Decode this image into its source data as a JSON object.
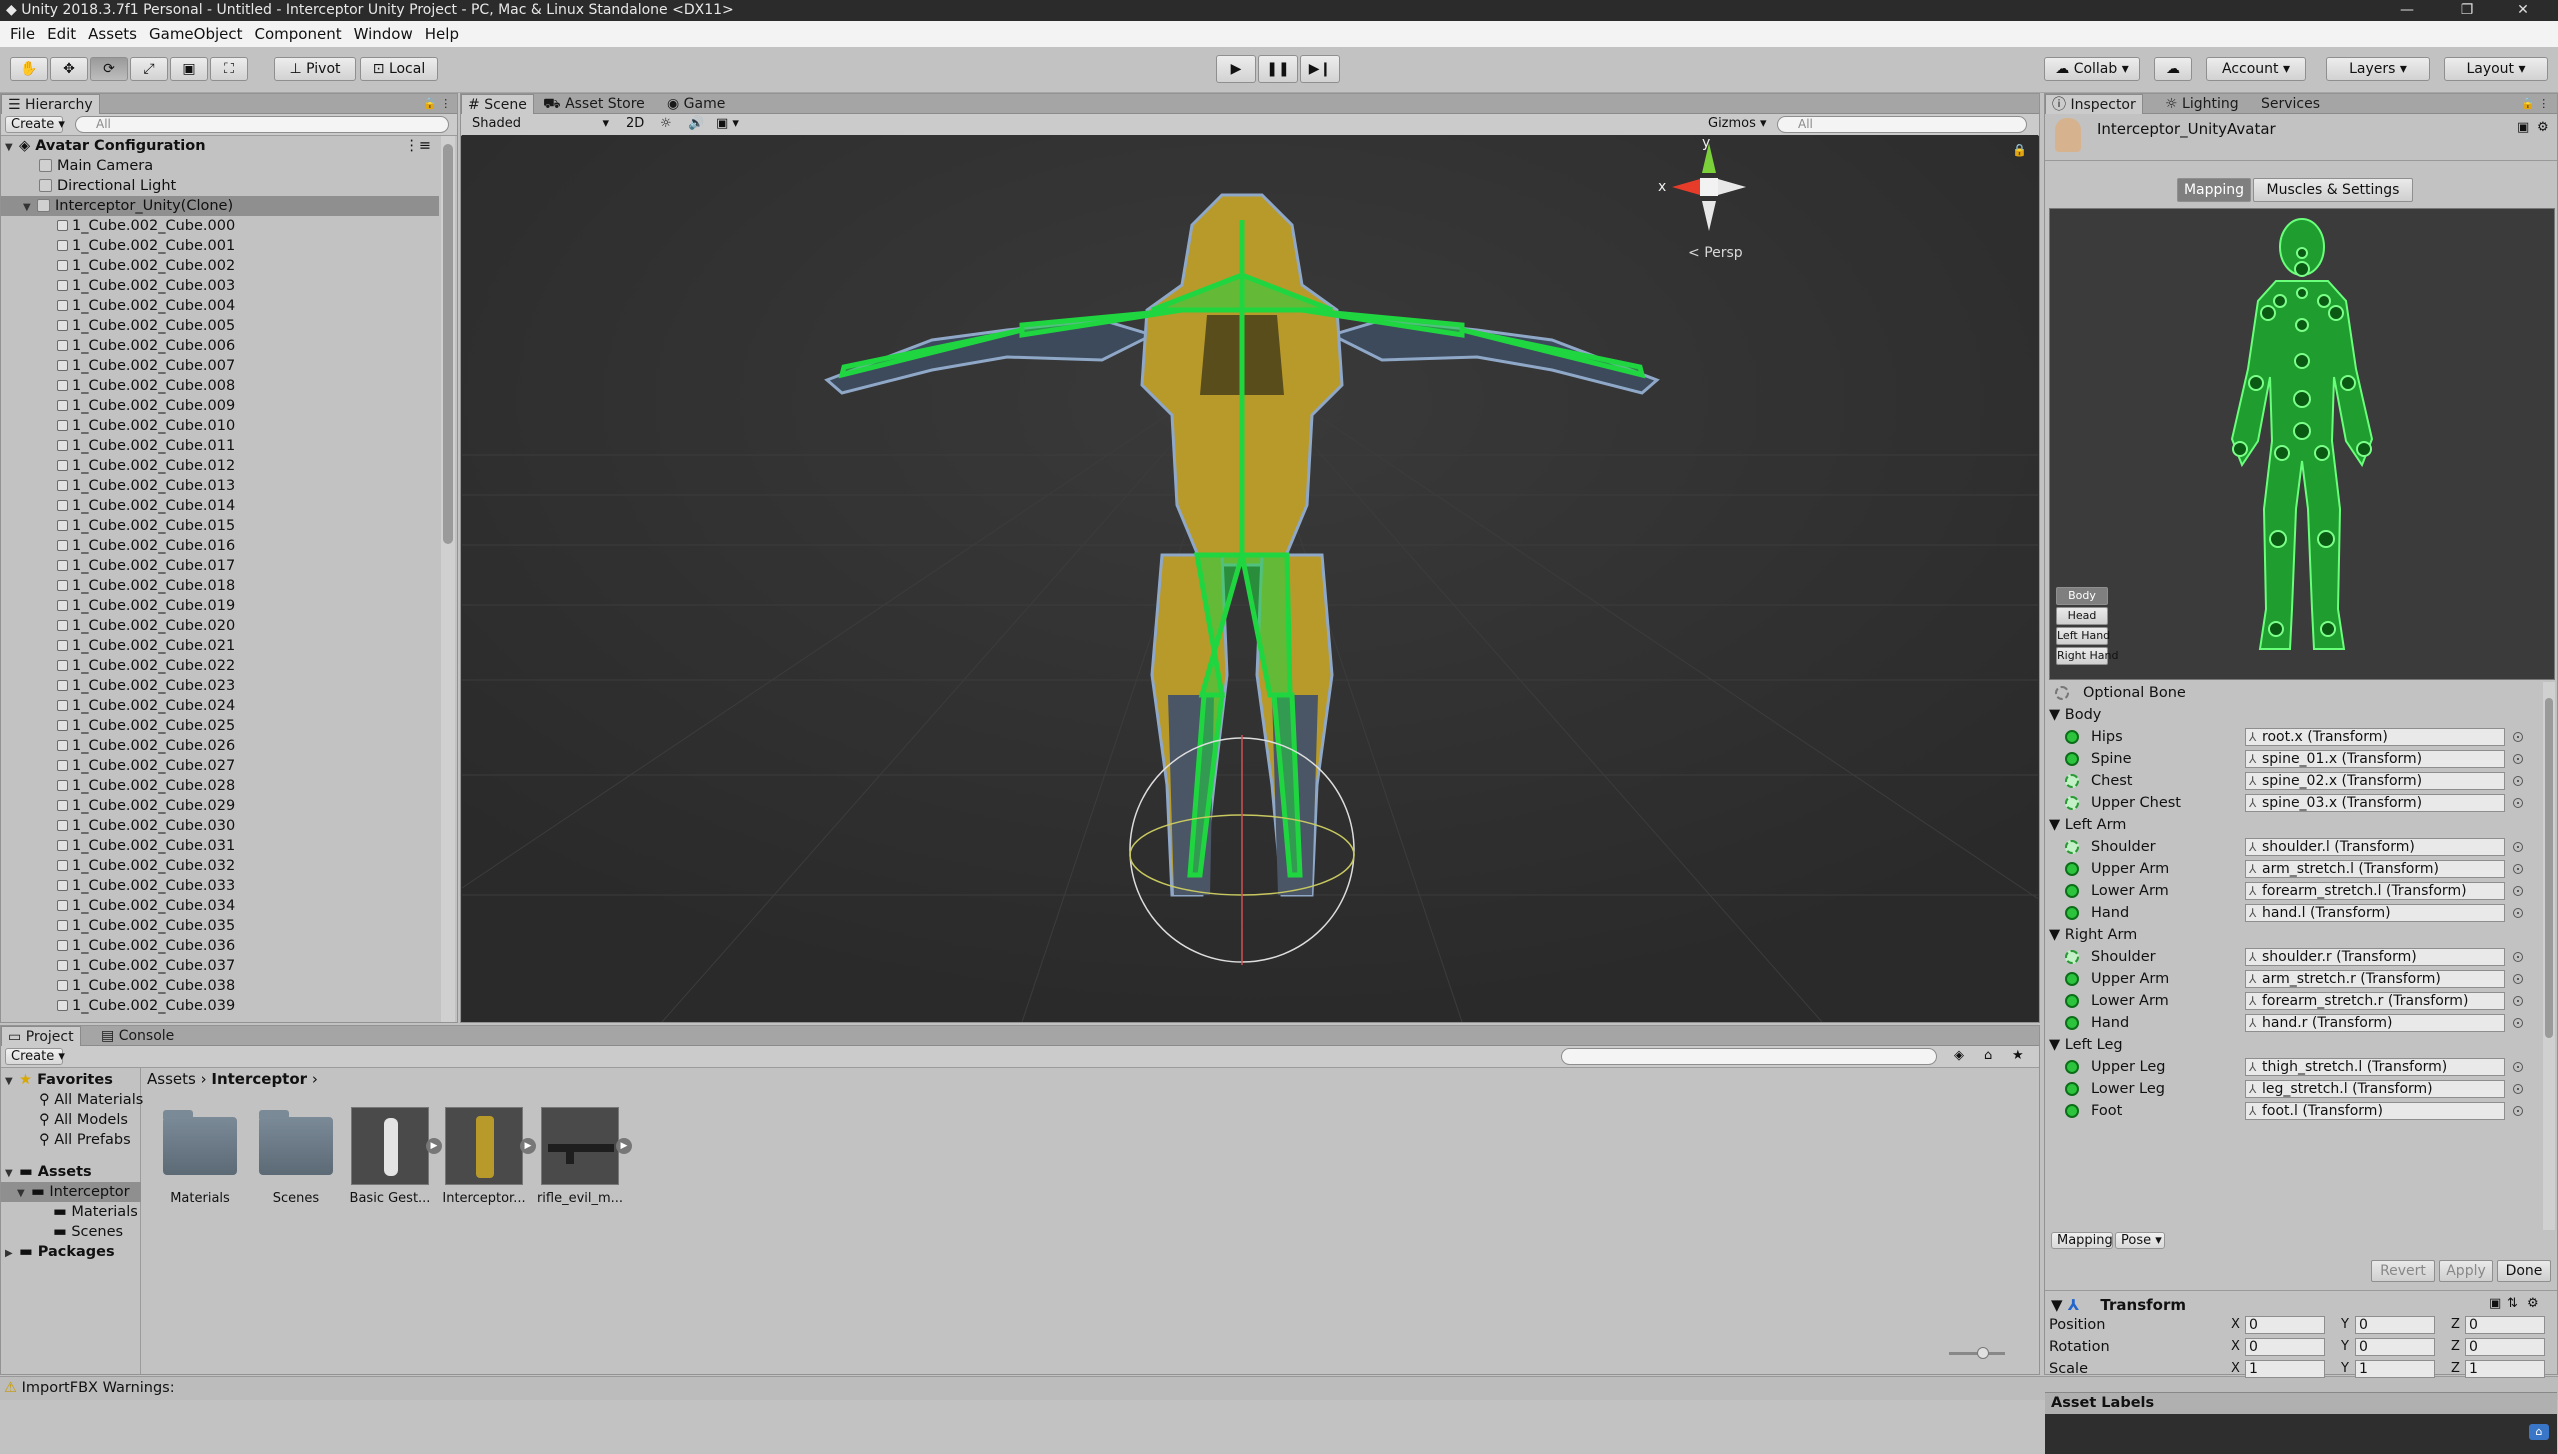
{
  "window": {
    "title": "Unity 2018.3.7f1 Personal - Untitled - Interceptor Unity Project - PC, Mac & Linux Standalone <DX11>"
  },
  "menu": [
    "File",
    "Edit",
    "Assets",
    "GameObject",
    "Component",
    "Window",
    "Help"
  ],
  "toolbar": {
    "pivot": "Pivot",
    "local": "Local",
    "collab": "Collab",
    "account": "Account",
    "layers": "Layers",
    "layout": "Layout"
  },
  "hierarchy": {
    "tab": "Hierarchy",
    "create": "Create",
    "search_placeholder": "All",
    "scene_name": "Avatar Configuration",
    "items": [
      "Main Camera",
      "Directional Light",
      "Interceptor_Unity(Clone)"
    ],
    "children": [
      "1_Cube.002_Cube.000",
      "1_Cube.002_Cube.001",
      "1_Cube.002_Cube.002",
      "1_Cube.002_Cube.003",
      "1_Cube.002_Cube.004",
      "1_Cube.002_Cube.005",
      "1_Cube.002_Cube.006",
      "1_Cube.002_Cube.007",
      "1_Cube.002_Cube.008",
      "1_Cube.002_Cube.009",
      "1_Cube.002_Cube.010",
      "1_Cube.002_Cube.011",
      "1_Cube.002_Cube.012",
      "1_Cube.002_Cube.013",
      "1_Cube.002_Cube.014",
      "1_Cube.002_Cube.015",
      "1_Cube.002_Cube.016",
      "1_Cube.002_Cube.017",
      "1_Cube.002_Cube.018",
      "1_Cube.002_Cube.019",
      "1_Cube.002_Cube.020",
      "1_Cube.002_Cube.021",
      "1_Cube.002_Cube.022",
      "1_Cube.002_Cube.023",
      "1_Cube.002_Cube.024",
      "1_Cube.002_Cube.025",
      "1_Cube.002_Cube.026",
      "1_Cube.002_Cube.027",
      "1_Cube.002_Cube.028",
      "1_Cube.002_Cube.029",
      "1_Cube.002_Cube.030",
      "1_Cube.002_Cube.031",
      "1_Cube.002_Cube.032",
      "1_Cube.002_Cube.033",
      "1_Cube.002_Cube.034",
      "1_Cube.002_Cube.035",
      "1_Cube.002_Cube.036",
      "1_Cube.002_Cube.037",
      "1_Cube.002_Cube.038",
      "1_Cube.002_Cube.039"
    ]
  },
  "scene": {
    "tabs": [
      "Scene",
      "Asset Store",
      "Game"
    ],
    "shading": "Shaded",
    "mode_2d": "2D",
    "gizmos": "Gizmos",
    "search_placeholder": "All",
    "persp": "Persp",
    "axis_y": "y",
    "axis_x": "x"
  },
  "project": {
    "tabs": [
      "Project",
      "Console"
    ],
    "create": "Create",
    "favorites": "Favorites",
    "favorite_items": [
      "All Materials",
      "All Models",
      "All Prefabs"
    ],
    "assets_root": "Assets",
    "tree": [
      "Interceptor",
      "Materials",
      "Scenes"
    ],
    "packages": "Packages",
    "breadcrumb": [
      "Assets",
      "Interceptor"
    ],
    "assets": [
      "Materials",
      "Scenes",
      "Basic Gest...",
      "Interceptor...",
      "rifle_evil_m..."
    ]
  },
  "status": {
    "text": "ImportFBX Warnings:"
  },
  "inspector": {
    "tabs": [
      "Inspector",
      "Lighting",
      "Services"
    ],
    "object_name": "Interceptor_UnityAvatar",
    "mode_tabs": [
      "Mapping",
      "Muscles & Settings"
    ],
    "body_buttons": [
      "Body",
      "Head",
      "Left Hand",
      "Right Hand"
    ],
    "optional_bone": "Optional Bone",
    "sections": [
      {
        "name": "Body",
        "bones": [
          {
            "label": "Hips",
            "value": "root.x (Transform)",
            "optional": false
          },
          {
            "label": "Spine",
            "value": "spine_01.x (Transform)",
            "optional": false
          },
          {
            "label": "Chest",
            "value": "spine_02.x (Transform)",
            "optional": true
          },
          {
            "label": "Upper Chest",
            "value": "spine_03.x (Transform)",
            "optional": true
          }
        ]
      },
      {
        "name": "Left Arm",
        "bones": [
          {
            "label": "Shoulder",
            "value": "shoulder.l (Transform)",
            "optional": true
          },
          {
            "label": "Upper Arm",
            "value": "arm_stretch.l (Transform)",
            "optional": false
          },
          {
            "label": "Lower Arm",
            "value": "forearm_stretch.l (Transform)",
            "optional": false
          },
          {
            "label": "Hand",
            "value": "hand.l (Transform)",
            "optional": false
          }
        ]
      },
      {
        "name": "Right Arm",
        "bones": [
          {
            "label": "Shoulder",
            "value": "shoulder.r (Transform)",
            "optional": true
          },
          {
            "label": "Upper Arm",
            "value": "arm_stretch.r (Transform)",
            "optional": false
          },
          {
            "label": "Lower Arm",
            "value": "forearm_stretch.r (Transform)",
            "optional": false
          },
          {
            "label": "Hand",
            "value": "hand.r (Transform)",
            "optional": false
          }
        ]
      },
      {
        "name": "Left Leg",
        "bones": [
          {
            "label": "Upper Leg",
            "value": "thigh_stretch.l (Transform)",
            "optional": false
          },
          {
            "label": "Lower Leg",
            "value": "leg_stretch.l (Transform)",
            "optional": false
          },
          {
            "label": "Foot",
            "value": "foot.l (Transform)",
            "optional": false
          }
        ]
      }
    ],
    "bottom_dd": [
      "Mapping",
      "Pose"
    ],
    "revert": "Revert",
    "apply": "Apply",
    "done": "Done",
    "transform": {
      "title": "Transform",
      "rows": [
        {
          "label": "Position",
          "x": "0",
          "y": "0",
          "z": "0"
        },
        {
          "label": "Rotation",
          "x": "0",
          "y": "0",
          "z": "0"
        },
        {
          "label": "Scale",
          "x": "1",
          "y": "1",
          "z": "1"
        }
      ]
    },
    "asset_labels": "Asset Labels"
  },
  "colors": {
    "bone_green": "#2cc43c",
    "robot_gold": "#b89a2a",
    "scene_bg": "#303030"
  }
}
